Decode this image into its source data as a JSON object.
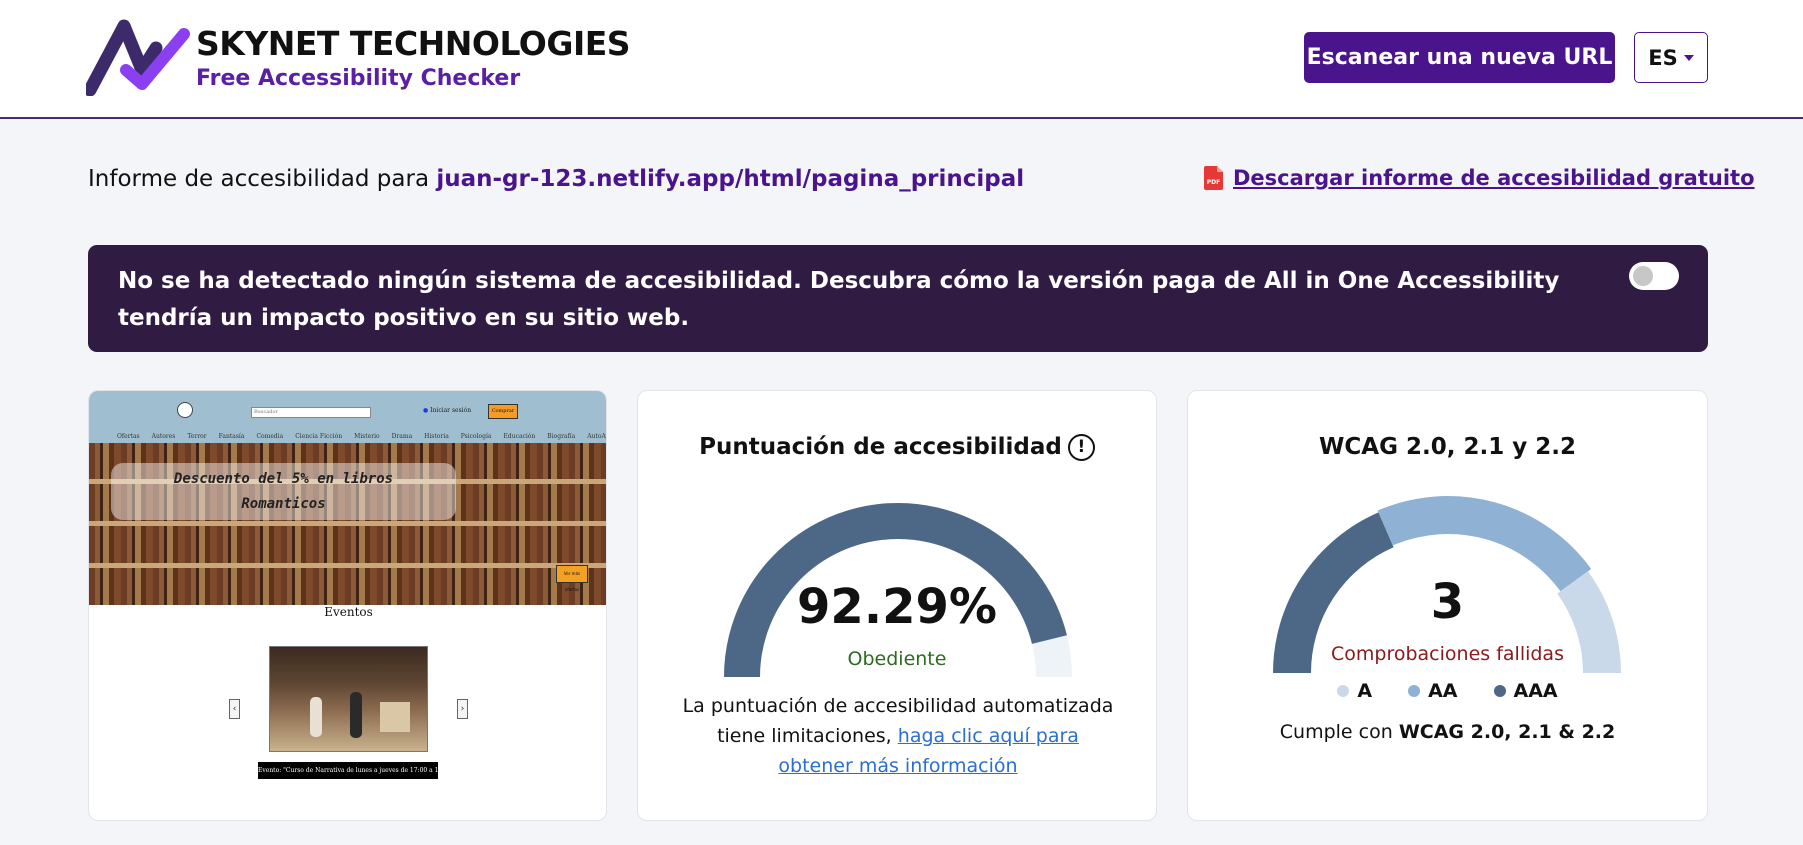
{
  "header": {
    "brand_title": "SKYNET TECHNOLOGIES",
    "brand_subtitle": "Free Accessibility Checker",
    "scan_button": "Escanear una nueva URL",
    "language": "ES"
  },
  "report": {
    "prefix": "Informe de accesibilidad para",
    "url": "juan-gr-123.netlify.app/html/pagina_principal",
    "download_label": "Descargar informe de accesibilidad gratuito",
    "pdf_icon_text": "PDF"
  },
  "banner": {
    "text": "No se ha detectado ningún sistema de accesibilidad. Descubra cómo la versión paga de All in One Accessibility tendría un impacto positivo en su sitio web.",
    "toggle_on": false
  },
  "thumbnail": {
    "search_placeholder": "Buscador",
    "login": "Iniciar sesión",
    "buy": "Comprar",
    "menu": [
      "Ofertas",
      "Autores",
      "Terror",
      "Fantasía",
      "Comedia",
      "Ciencia Ficción",
      "Misterio",
      "Drama",
      "Historia",
      "Psicología",
      "Educación",
      "Biografía",
      "AutoAyuda"
    ],
    "hero_line1": "Descuento del 5% en libros",
    "hero_line2": "Romanticos",
    "hero_button": "Ver más ofertas",
    "events_title": "Eventos",
    "arrow_left": "‹",
    "arrow_right": "›",
    "caption": "Evento: \"Curso de Narrativa de lunes a jueves de 17:00 a 18:00\""
  },
  "score_card": {
    "title": "Puntuación de accesibilidad",
    "info_icon": "!",
    "score": "92.29%",
    "score_fraction": 0.9229,
    "status": "Obediente",
    "note_text": "La puntuación de accesibilidad automatizada tiene limitaciones,",
    "note_link": "haga clic aquí para obtener más información",
    "colors": {
      "fill": "#4d6886",
      "track": "#eef3f8"
    }
  },
  "wcag_card": {
    "title": "WCAG 2.0, 2.1 y 2.2",
    "failed_count": "3",
    "failed_label": "Comprobaciones fallidas",
    "legend": [
      {
        "label": "A",
        "color": "#c9d9ea"
      },
      {
        "label": "AA",
        "color": "#8fb1d4"
      },
      {
        "label": "AAA",
        "color": "#4d6886"
      }
    ],
    "comply_prefix": "Cumple con",
    "comply_value": "WCAG 2.0, 2.1 & 2.2"
  }
}
